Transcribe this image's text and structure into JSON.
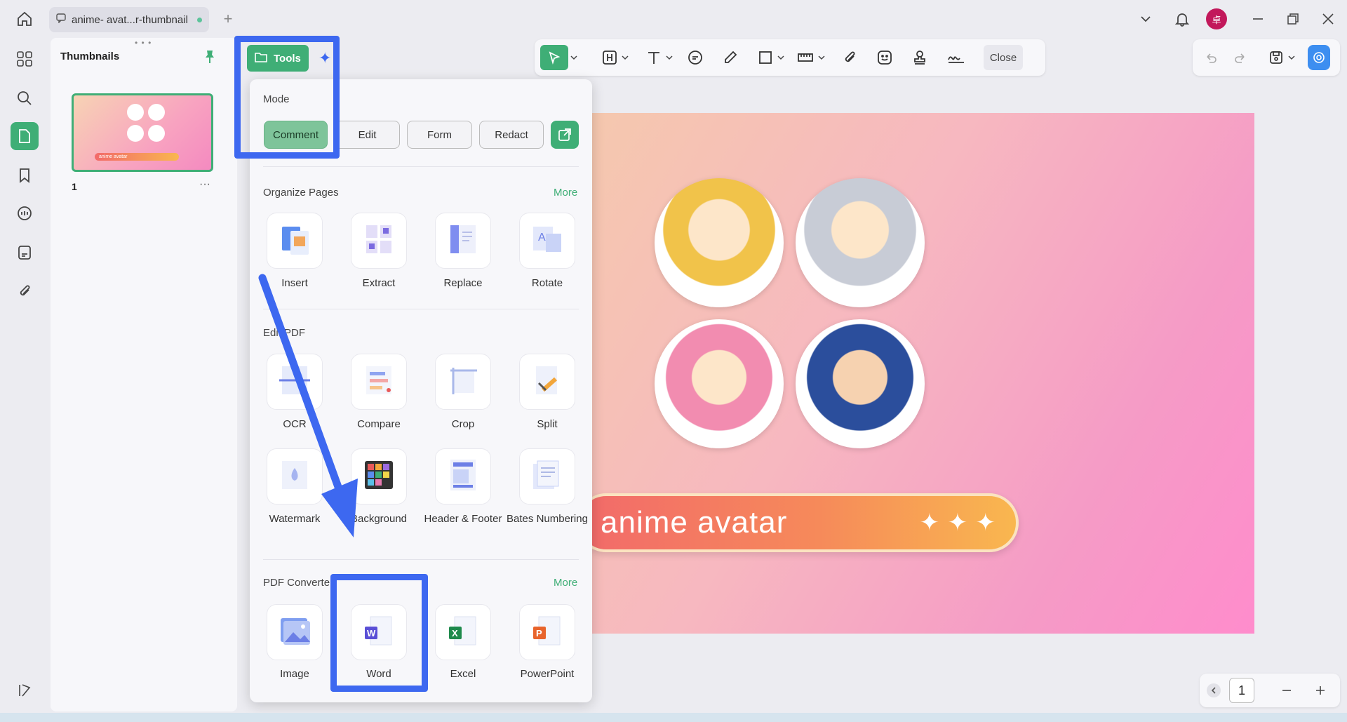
{
  "tab": {
    "title": "anime- avat...r-thumbnail"
  },
  "thumbnails": {
    "title": "Thumbnails",
    "page_number": "1",
    "thumb_banner_text": "anime avatar"
  },
  "tools_button": {
    "label": "Tools"
  },
  "toolbar": {
    "close_label": "Close"
  },
  "popup": {
    "mode_title": "Mode",
    "modes": [
      "Comment",
      "Edit",
      "Form",
      "Redact"
    ],
    "active_mode": "Comment",
    "organize": {
      "title": "Organize Pages",
      "more": "More",
      "items": [
        "Insert",
        "Extract",
        "Replace",
        "Rotate"
      ]
    },
    "edit_pdf": {
      "title": "Edit PDF",
      "items": [
        "OCR",
        "Compare",
        "Crop",
        "Split",
        "Watermark",
        "Background",
        "Header & Footer",
        "Bates Numbering"
      ]
    },
    "converter": {
      "title": "PDF Converter",
      "more": "More",
      "items": [
        "Image",
        "Word",
        "Excel",
        "PowerPoint"
      ]
    }
  },
  "document": {
    "banner_text": "anime avatar"
  },
  "page_nav": {
    "current_page": "1"
  },
  "colors": {
    "accent": "#3fae76",
    "highlight": "#3d68f0",
    "avatar": "#c2185b"
  },
  "avatar_initial": "卓"
}
